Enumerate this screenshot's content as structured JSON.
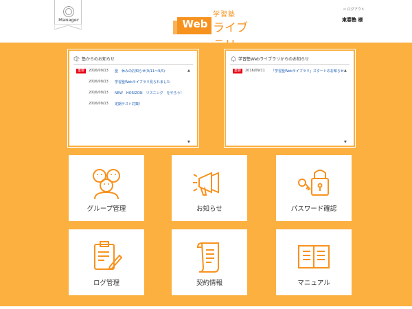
{
  "header": {
    "badge_label": "Manager",
    "logo": {
      "small_text": "学習塾",
      "web_text": "Web",
      "big_text": "ライブラリ"
    },
    "logout_label": "ログアウト",
    "user_name": "東春塾 様"
  },
  "panels": {
    "left": {
      "title": "塾からのお知らせ",
      "items": [
        {
          "badge": "重要",
          "date": "2016/09/13",
          "title": "塾　休みのお知らせ(9/11〜9/5)"
        },
        {
          "badge": "",
          "date": "2016/09/13",
          "title": "学習塾Webライブラリ見られました"
        },
        {
          "badge": "",
          "date": "2016/09/13",
          "title": "NEW　HORIZON　リスニング　をやろう！"
        },
        {
          "badge": "",
          "date": "2016/09/13",
          "title": "定期テスト対策！"
        }
      ]
    },
    "right": {
      "title": "学習塾Webライブラリからのお知らせ",
      "items": [
        {
          "badge": "重要",
          "date": "2016/09/11",
          "title": "「学習塾Webライブラリ」スタートのお知らせ"
        }
      ]
    }
  },
  "tiles": {
    "group": {
      "label": "グループ管理",
      "icon": "group-icon"
    },
    "notice": {
      "label": "お知らせ",
      "icon": "megaphone-icon"
    },
    "password": {
      "label": "パスワード確認",
      "icon": "key-lock-icon"
    },
    "log": {
      "label": "ログ管理",
      "icon": "clipboard-pen-icon"
    },
    "contract": {
      "label": "契約情報",
      "icon": "document-scroll-icon"
    },
    "manual": {
      "label": "マニュアル",
      "icon": "open-book-icon"
    }
  },
  "colors": {
    "brand_orange": "#f7921e",
    "background_orange": "#fbb040",
    "important_red": "#e60012",
    "link_blue": "#1f5fb4"
  }
}
